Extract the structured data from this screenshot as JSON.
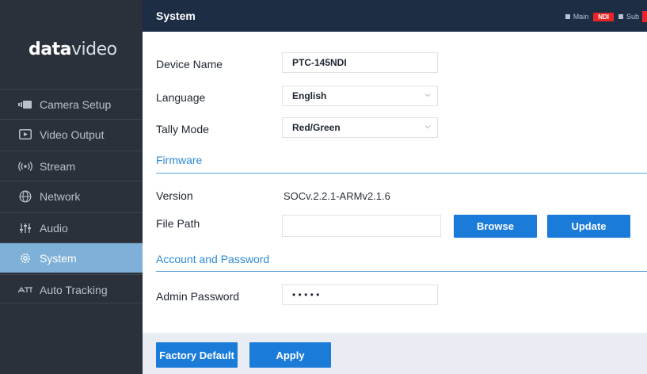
{
  "brand": {
    "logo_bold": "data",
    "logo_light": "video"
  },
  "header": {
    "title": "System",
    "legend": {
      "main": "Main",
      "ndi": "NDI",
      "sub": "Sub"
    }
  },
  "sidebar": {
    "items": [
      {
        "label": "Camera Setup",
        "icon": "camera-icon"
      },
      {
        "label": "Video Output",
        "icon": "video-output-icon"
      },
      {
        "label": "Stream",
        "icon": "stream-icon"
      },
      {
        "label": "Network",
        "icon": "globe-icon"
      },
      {
        "label": "Audio",
        "icon": "audio-sliders-icon"
      },
      {
        "label": "System",
        "icon": "gear-icon",
        "active": true
      },
      {
        "label": "Auto Tracking",
        "icon": "auto-tracking-icon"
      }
    ]
  },
  "form": {
    "device_name": {
      "label": "Device Name",
      "value": "PTC-145NDI"
    },
    "language": {
      "label": "Language",
      "value": "English"
    },
    "tally_mode": {
      "label": "Tally Mode",
      "value": "Red/Green"
    },
    "firmware_section": "Firmware",
    "version": {
      "label": "Version",
      "value": "SOCv.2.2.1-ARMv2.1.6"
    },
    "file_path": {
      "label": "File Path",
      "value": ""
    },
    "browse_label": "Browse",
    "update_label": "Update",
    "account_section": "Account and Password",
    "admin_password": {
      "label": "Admin Password",
      "value": "• • • • •"
    }
  },
  "footer": {
    "factory_default_label": "Factory Default",
    "apply_label": "Apply"
  },
  "colors": {
    "accent": "#1a7bd9",
    "sidebar": "#2a313a",
    "header": "#1d2d44",
    "active_nav": "#7fb1d8",
    "ndi_red": "#e8262a"
  }
}
